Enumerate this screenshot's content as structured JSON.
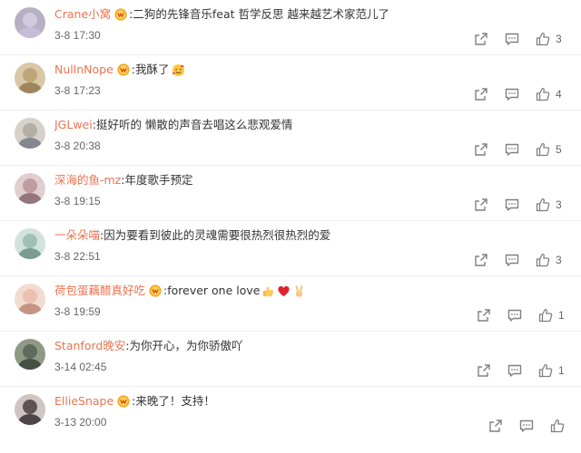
{
  "comments": [
    {
      "username": "Crane小窝",
      "vip": true,
      "separator": ":",
      "text": "二狗的先锋音乐feat 哲学反思 越来越艺术家范儿了",
      "emojis": [],
      "time": "3-8 17:30",
      "likes": "3",
      "avatar_colors": [
        "#d9d3e8",
        "#c9c2dd",
        "#b6b0c4"
      ]
    },
    {
      "username": "NullnNope",
      "vip": true,
      "separator": ":",
      "text": "我酥了",
      "emojis": [
        "smiling-face-with-hearts-emoji"
      ],
      "time": "3-8 17:23",
      "likes": "4",
      "avatar_colors": [
        "#b89a6a",
        "#8c6f45",
        "#d8c8a8"
      ]
    },
    {
      "username": "JGLwei",
      "vip": false,
      "separator": ":",
      "text": "挺好听的 懒散的声音去唱这么悲观爱情",
      "emojis": [],
      "time": "3-8 20:38",
      "likes": "5",
      "avatar_colors": [
        "#a7a29a",
        "#6b6e7a",
        "#d6d2c9"
      ]
    },
    {
      "username": "深海的鱼-mz",
      "vip": false,
      "separator": ":",
      "text": "年度歌手预定",
      "emojis": [],
      "time": "3-8 19:15",
      "likes": "3",
      "avatar_colors": [
        "#b58a8f",
        "#7a5a62",
        "#e0cfd0"
      ]
    },
    {
      "username": "一朵朵喵",
      "vip": false,
      "separator": ":",
      "text": "因为要看到彼此的灵魂需要很热烈很热烈的爱",
      "emojis": [],
      "time": "3-8 22:51",
      "likes": "3",
      "avatar_colors": [
        "#8cb5a8",
        "#5e8479",
        "#d2e2dc"
      ]
    },
    {
      "username": "荷包蛋藕醋真好吃",
      "vip": true,
      "separator": ":",
      "text": "forever one love",
      "emojis": [
        "thumbs-up-emoji",
        "red-heart-emoji",
        "victory-hand-emoji"
      ],
      "time": "3-8 19:59",
      "likes": "1",
      "avatar_colors": [
        "#e8b7a5",
        "#b67c68",
        "#f2dcd0"
      ]
    },
    {
      "username": "Stanford晚安",
      "vip": false,
      "separator": ":",
      "text": "为你开心，为你骄傲吖",
      "emojis": [],
      "time": "3-14 02:45",
      "likes": "1",
      "avatar_colors": [
        "#4e5a4d",
        "#2e372f",
        "#8f9a86"
      ]
    },
    {
      "username": "EllieSnape",
      "vip": true,
      "separator": ":",
      "text": "来晚了！支持！",
      "emojis": [],
      "time": "3-13 20:00",
      "likes": "",
      "avatar_colors": [
        "#3a2c30",
        "#221a1d",
        "#cfc6c3"
      ]
    }
  ],
  "icons": {
    "share": "share-icon",
    "comment": "comment-icon",
    "like": "thumbs-up-icon"
  },
  "colors": {
    "username": "#eb7350",
    "text": "#333333",
    "meta": "#666666",
    "icon": "#808080"
  }
}
